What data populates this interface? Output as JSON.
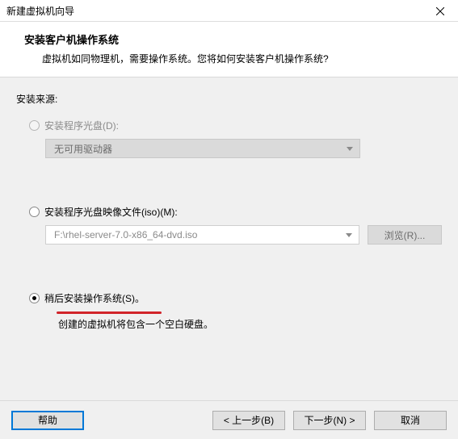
{
  "titlebar": {
    "title": "新建虚拟机向导"
  },
  "header": {
    "title": "安装客户机操作系统",
    "subtitle": "虚拟机如同物理机，需要操作系统。您将如何安装客户机操作系统?"
  },
  "source": {
    "label": "安装来源:",
    "option_disc": {
      "label": "安装程序光盘(D):",
      "dropdown_value": "无可用驱动器"
    },
    "option_iso": {
      "label": "安装程序光盘映像文件(iso)(M):",
      "path_value": "F:\\rhel-server-7.0-x86_64-dvd.iso",
      "browse_label": "浏览(R)..."
    },
    "option_later": {
      "label": "稍后安装操作系统(S)。",
      "note": "创建的虚拟机将包含一个空白硬盘。"
    }
  },
  "footer": {
    "help": "帮助",
    "back": "< 上一步(B)",
    "next": "下一步(N) >",
    "cancel": "取消"
  }
}
